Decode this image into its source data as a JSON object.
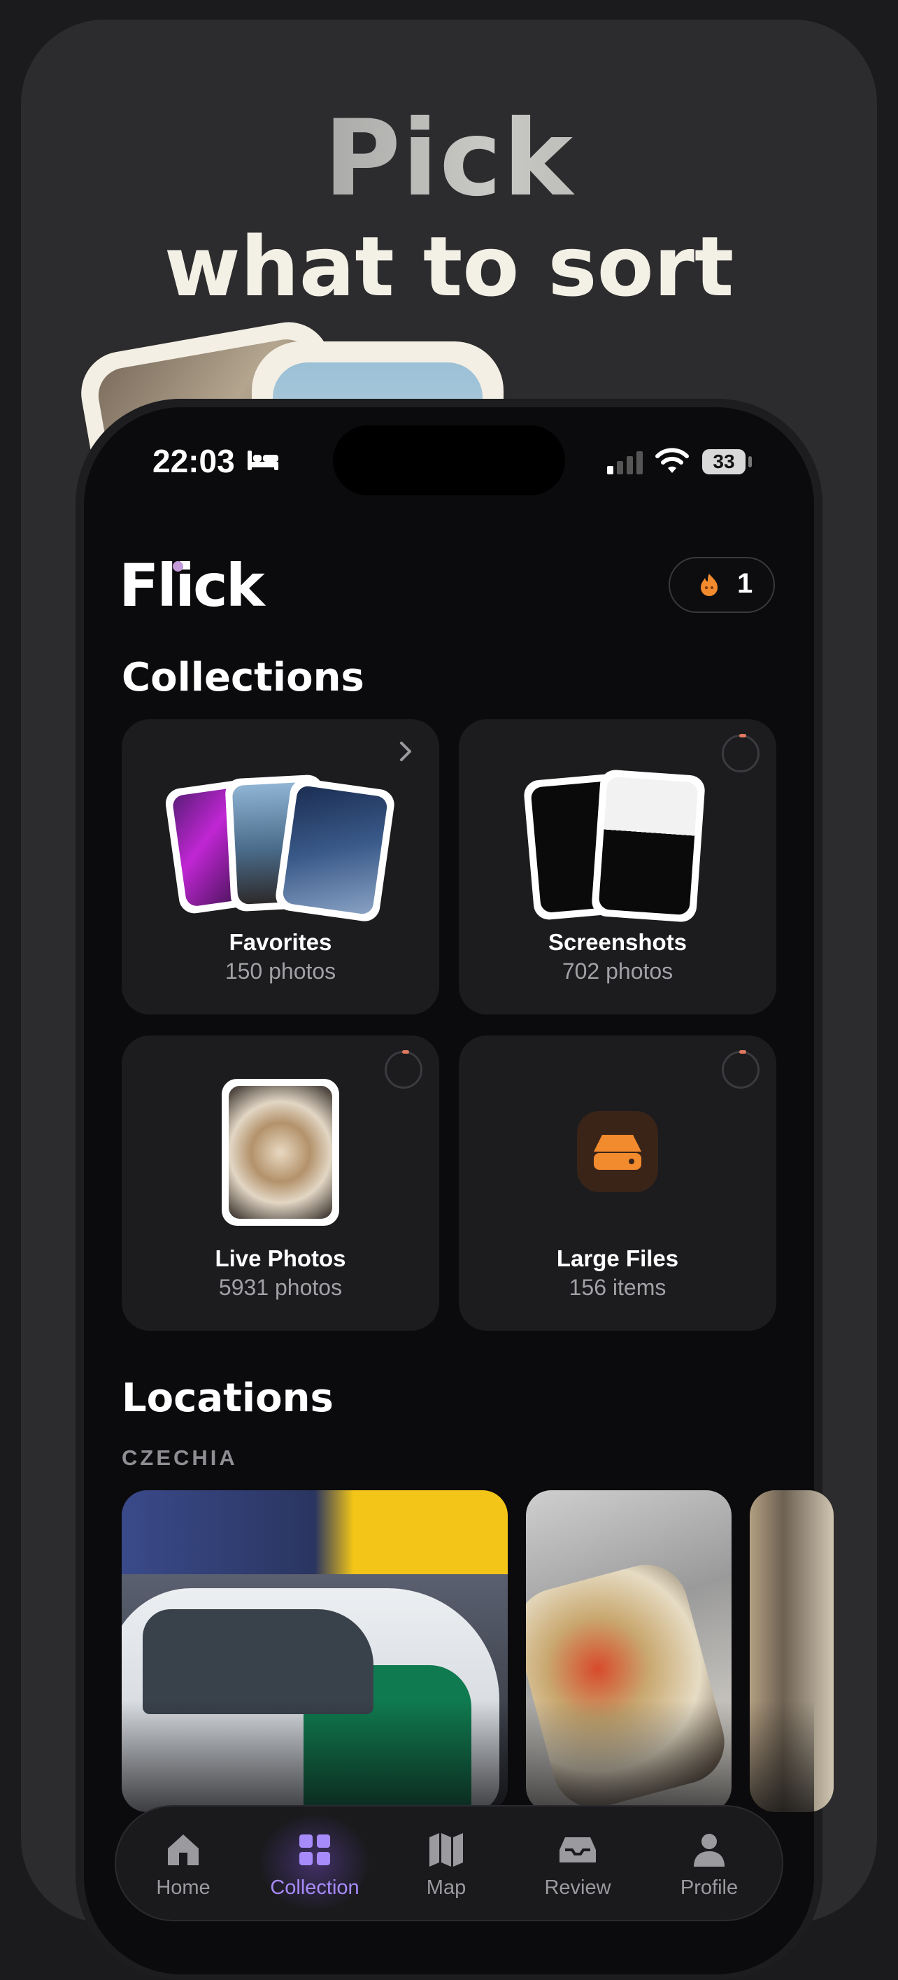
{
  "promo": {
    "line1": "Pick",
    "line2": "what to sort"
  },
  "status_bar": {
    "time": "22:03",
    "battery": "33"
  },
  "header": {
    "logo": "Flick",
    "streak_count": "1",
    "streak_icon": "flame-icon"
  },
  "collections": {
    "title": "Collections",
    "items": [
      {
        "name": "Favorites",
        "count": "150 photos"
      },
      {
        "name": "Screenshots",
        "count": "702 photos"
      },
      {
        "name": "Live Photos",
        "count": "5931 photos"
      },
      {
        "name": "Large Files",
        "count": "156 items"
      }
    ]
  },
  "locations": {
    "title": "Locations",
    "country": "CZECHIA"
  },
  "tabs": [
    {
      "label": "Home",
      "icon": "home-icon"
    },
    {
      "label": "Collection",
      "icon": "grid-icon",
      "active": true
    },
    {
      "label": "Map",
      "icon": "map-icon"
    },
    {
      "label": "Review",
      "icon": "inbox-icon"
    },
    {
      "label": "Profile",
      "icon": "person-icon"
    }
  ],
  "colors": {
    "accent": "#a78bfa",
    "orange": "#f28a2e",
    "background": "#0b0b0d"
  }
}
